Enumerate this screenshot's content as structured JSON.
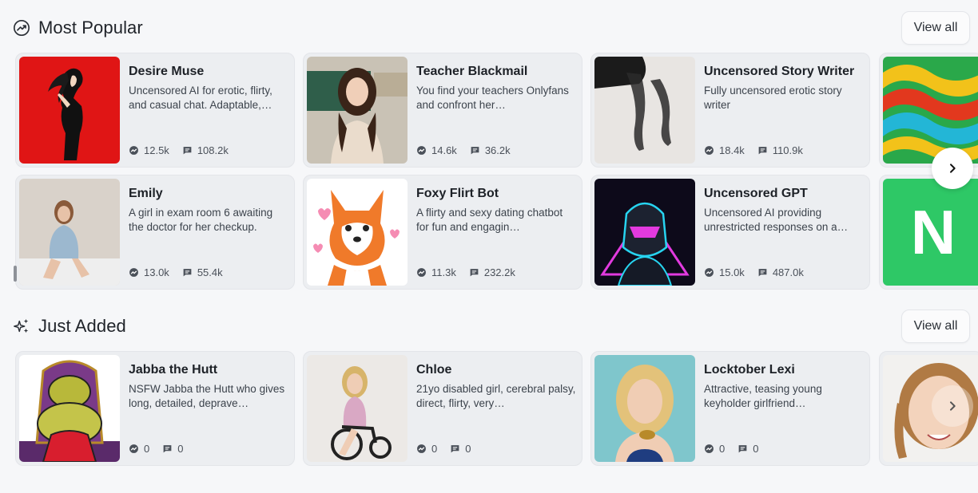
{
  "popular": {
    "title": "Most Popular",
    "icon": "trending-chart-icon",
    "view_all": "View all",
    "cards": [
      {
        "name": "Desire Muse",
        "desc": "Uncensored AI for erotic, flirty, and casual chat. Adaptable,…",
        "views": "12.5k",
        "messages": "108.2k"
      },
      {
        "name": "Teacher Blackmail",
        "desc": "You find your teachers Onlyfans and confront her…",
        "views": "14.6k",
        "messages": "36.2k"
      },
      {
        "name": "Uncensored Story Writer",
        "desc": "Fully uncensored erotic story writer",
        "views": "18.4k",
        "messages": "110.9k"
      },
      {
        "name": "Emily",
        "desc": "A girl in exam room 6 awaiting the doctor for her checkup.",
        "views": "13.0k",
        "messages": "55.4k"
      },
      {
        "name": "Foxy Flirt Bot",
        "desc": "A flirty and sexy dating chatbot for fun and engagin…",
        "views": "11.3k",
        "messages": "232.2k"
      },
      {
        "name": "Uncensored GPT",
        "desc": "Uncensored AI providing unrestricted responses on a…",
        "views": "15.0k",
        "messages": "487.0k"
      }
    ],
    "partial_letter": "N"
  },
  "just_added": {
    "title": "Just Added",
    "icon": "sparkles-icon",
    "view_all": "View all",
    "cards": [
      {
        "name": "Jabba the Hutt",
        "desc": "NSFW Jabba the Hutt who gives long, detailed, deprave…",
        "views": "0",
        "messages": "0"
      },
      {
        "name": "Chloe",
        "desc": "21yo disabled girl, cerebral palsy, direct, flirty, very…",
        "views": "0",
        "messages": "0"
      },
      {
        "name": "Locktober Lexi",
        "desc": "Attractive, teasing young keyholder girlfriend…",
        "views": "0",
        "messages": "0"
      }
    ]
  },
  "colors": {
    "page_bg": "#f6f7f9",
    "card_bg": "#eceef1",
    "accent_green": "#2ec866"
  }
}
